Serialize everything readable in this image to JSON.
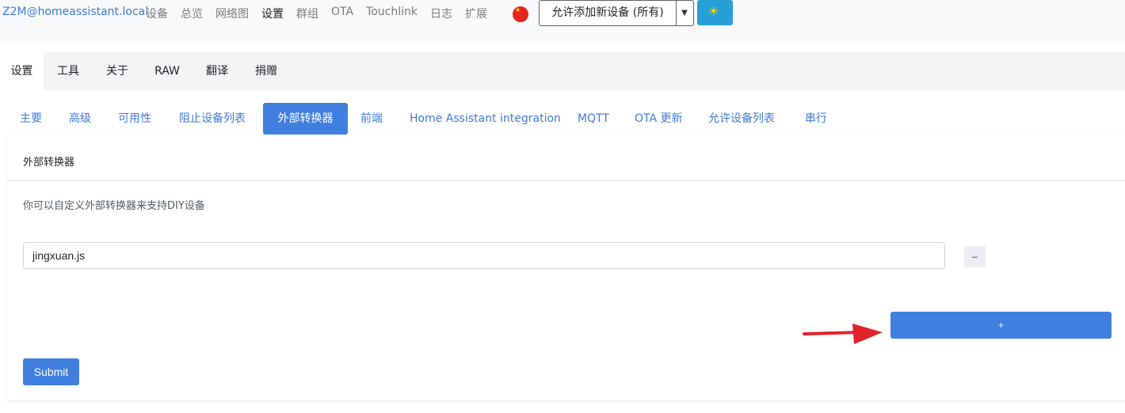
{
  "navbar": {
    "brand": "Z2M@homeassistant.local",
    "links": [
      "设备",
      "总览",
      "网络图",
      "设置",
      "群组",
      "OTA",
      "Touchlink",
      "日志",
      "扩展"
    ],
    "active_link": "设置",
    "permit_join_label": "允许添加新设备 (所有)",
    "language_flag": "cn-flag-icon",
    "theme_icon": "sun-icon"
  },
  "main_tabs": [
    "设置",
    "工具",
    "关于",
    "RAW",
    "翻译",
    "捐赠"
  ],
  "sub_tabs": [
    "主要",
    "高级",
    "可用性",
    "阻止设备列表",
    "外部转换器",
    "前端",
    "Home Assistant integration",
    "MQTT",
    "OTA 更新",
    "允许设备列表",
    "串行"
  ],
  "card": {
    "title": "外部转换器",
    "description": "你可以自定义外部转换器来支持DIY设备",
    "converters": [
      "jingxuan.js"
    ],
    "remove_label": "–",
    "add_label": "+",
    "submit_label": "Submit"
  },
  "colors": {
    "accent": "#3f7fe0",
    "link": "#3f7bd6",
    "arrow": "#e3232a",
    "theme_button": "#279ed8"
  }
}
